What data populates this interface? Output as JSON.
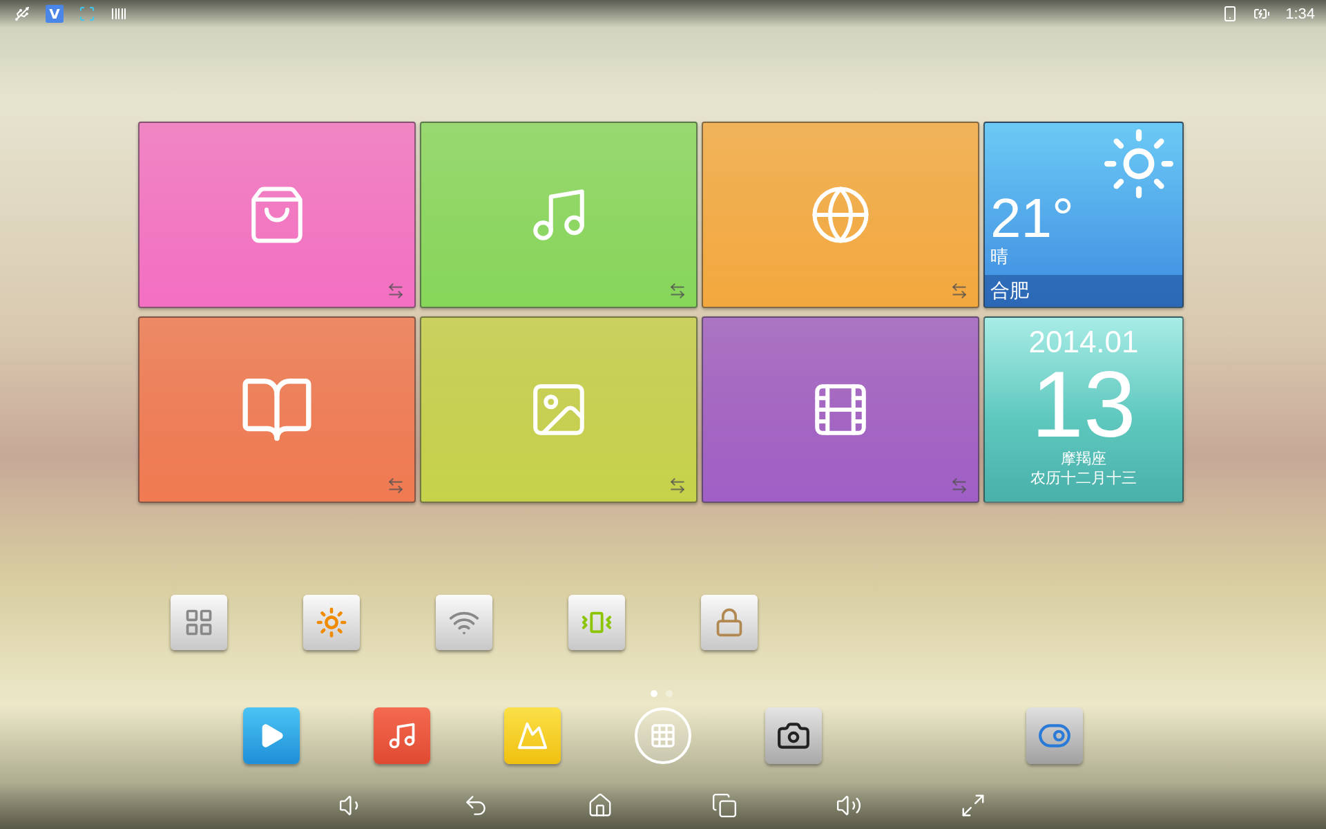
{
  "status_bar": {
    "notifications": [
      {
        "kind": "usb"
      },
      {
        "kind": "app",
        "label": "V"
      },
      {
        "kind": "scanner"
      },
      {
        "kind": "barcode"
      }
    ],
    "time": "1:34"
  },
  "tiles": [
    {
      "kind": "store",
      "color": "#f36fc2"
    },
    {
      "kind": "music",
      "color": "#86d65a"
    },
    {
      "kind": "browser",
      "color": "#f3a83e"
    },
    {
      "kind": "weather",
      "color": "#3d8be0",
      "temperature": "21°",
      "condition": "晴",
      "city": "合肥"
    },
    {
      "kind": "reader",
      "color": "#f07a52"
    },
    {
      "kind": "gallery",
      "color": "#c6d24a"
    },
    {
      "kind": "video",
      "color": "#a05fc6"
    },
    {
      "kind": "calendar",
      "color": "#5ec8be",
      "month": "2014.01",
      "day": "13",
      "sign": "摩羯座",
      "lunar": "农历十二月十三"
    }
  ],
  "toggles": [
    {
      "kind": "widgets"
    },
    {
      "kind": "brightness"
    },
    {
      "kind": "wifi"
    },
    {
      "kind": "vibrate"
    },
    {
      "kind": "lock"
    }
  ],
  "page_dots": [
    {
      "selected": true
    },
    {
      "selected": false
    }
  ],
  "dock": [
    {
      "kind": "video"
    },
    {
      "kind": "music"
    },
    {
      "kind": "gallery"
    },
    {
      "kind": "apps"
    },
    {
      "kind": "camera"
    },
    {
      "kind": "settings"
    }
  ],
  "nav_bar": [
    {
      "kind": "volume_down"
    },
    {
      "kind": "back"
    },
    {
      "kind": "home"
    },
    {
      "kind": "recents"
    },
    {
      "kind": "volume_up"
    },
    {
      "kind": "fullscreen"
    }
  ]
}
